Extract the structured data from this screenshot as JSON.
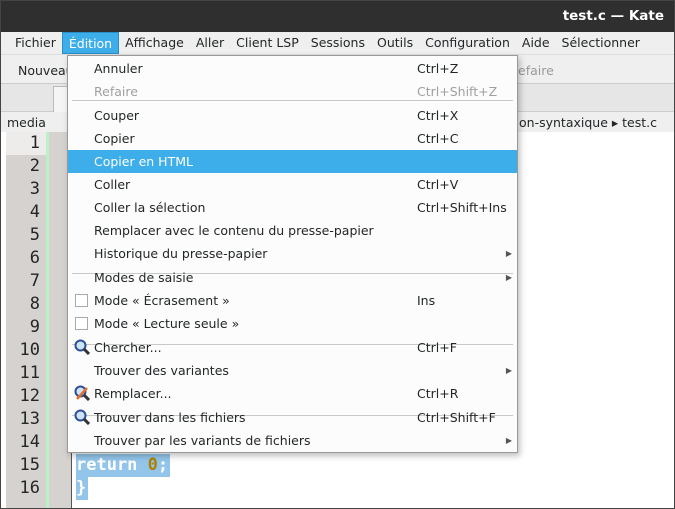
{
  "window": {
    "title": "test.c — Kate"
  },
  "menubar": [
    "Fichier",
    "Édition",
    "Affichage",
    "Aller",
    "Client LSP",
    "Sessions",
    "Outils",
    "Configuration",
    "Aide",
    "Sélectionner"
  ],
  "toolbar": {
    "new_label": "Nouveau",
    "redo_label": "efaire"
  },
  "breadcrumb": {
    "left": "media",
    "right": "on-syntaxique ▸ test.c"
  },
  "editor": {
    "line_numbers": [
      "1",
      "2",
      "3",
      "4",
      "5",
      "6",
      "7",
      "8",
      "9",
      "10",
      "11",
      "12",
      "13",
      "14",
      "15",
      "16"
    ],
    "line15_keyword": "return",
    "line15_number": "0",
    "line15_end": ";",
    "line16": "}"
  },
  "menu": {
    "items": [
      {
        "label": "Annuler",
        "shortcut": "Ctrl+Z"
      },
      {
        "label": "Refaire",
        "shortcut": "Ctrl+Shift+Z",
        "disabled": true
      },
      {
        "label": "Couper",
        "shortcut": "Ctrl+X"
      },
      {
        "label": "Copier",
        "shortcut": "Ctrl+C"
      },
      {
        "label": "Copier en HTML",
        "shortcut": "",
        "highlighted": true
      },
      {
        "label": "Coller",
        "shortcut": "Ctrl+V"
      },
      {
        "label": "Coller la sélection",
        "shortcut": "Ctrl+Shift+Ins"
      },
      {
        "label": "Remplacer avec le contenu du presse-papier",
        "shortcut": ""
      },
      {
        "label": "Historique du presse-papier",
        "shortcut": "",
        "submenu": true
      },
      {
        "label": "Modes de saisie",
        "shortcut": "",
        "submenu": true
      },
      {
        "label": "Mode « Écrasement »",
        "shortcut": "Ins",
        "checkbox": false
      },
      {
        "label": "Mode « Lecture seule »",
        "shortcut": "",
        "checkbox": false
      },
      {
        "label": "Chercher...",
        "shortcut": "Ctrl+F",
        "icon": "search-icon"
      },
      {
        "label": "Trouver des variantes",
        "shortcut": "",
        "submenu": true
      },
      {
        "label": "Remplacer...",
        "shortcut": "Ctrl+R",
        "icon": "replace-icon"
      },
      {
        "label": "Trouver dans les fichiers",
        "shortcut": "Ctrl+Shift+F",
        "icon": "search-icon"
      },
      {
        "label": "Trouver par les variants de fichiers",
        "shortcut": "",
        "submenu": true
      }
    ]
  },
  "colors": {
    "accent": "#3daee9",
    "titlebar": "#2f2f2f",
    "selection": "#93c5ea"
  }
}
